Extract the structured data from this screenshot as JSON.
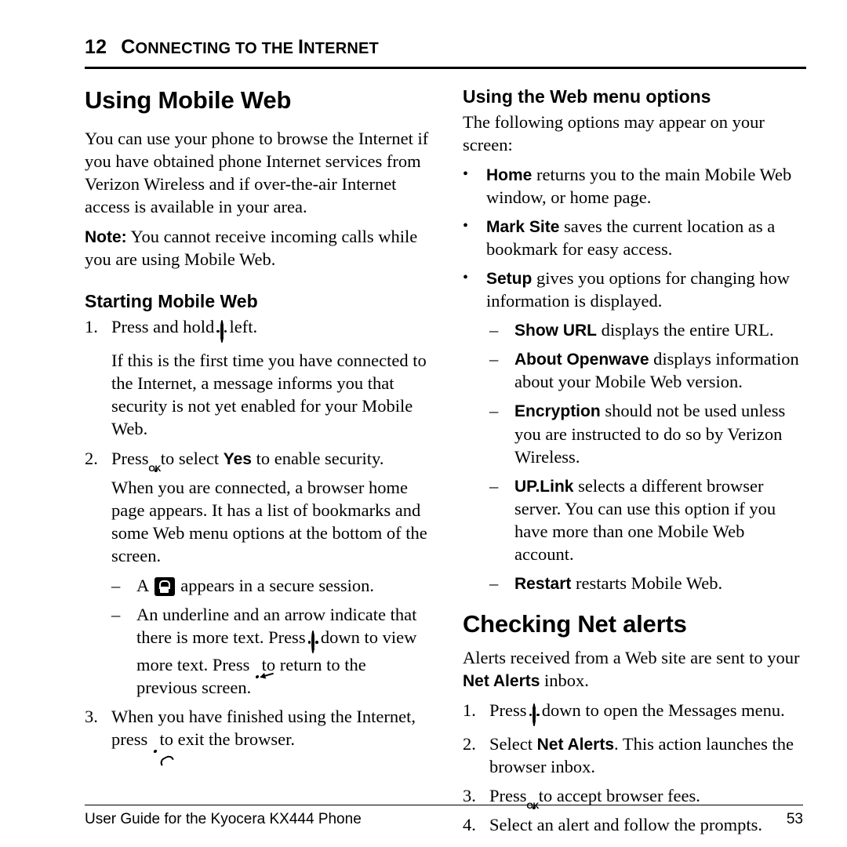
{
  "header": {
    "chapter_number": "12",
    "chapter_title_first": "C",
    "chapter_title_rest": "ONNECTING TO THE ",
    "chapter_title_i": "I",
    "chapter_title_tail": "NTERNET",
    "chapter_title_plain": "12 CONNECTING TO THE INTERNET"
  },
  "left": {
    "title": "Using Mobile Web",
    "intro": "You can use your phone to browse the Internet if you have obtained phone Internet services from Verizon Wireless and if over-the-air Internet access is available in your area.",
    "note_label": "Note:",
    "note_text": " You cannot receive incoming calls while you are using Mobile Web.",
    "starting_title": "Starting Mobile Web",
    "step1_marker": "1.",
    "step1_a": "Press and hold",
    "step1_b": "left.",
    "step1_follow": "If this is the first time you have connected to the Internet, a message informs you that security is not yet enabled for your Mobile Web.",
    "step2_marker": "2.",
    "step2_a": "Press",
    "step2_b": "to select",
    "step2_bold": "Yes",
    "step2_c": "to enable security.",
    "step2_follow": "When you are connected, a browser home page appears. It has a list of bookmarks and some Web menu options at the bottom of the screen.",
    "dash1_marker": "–",
    "dash1_a": "A",
    "dash1_b": "appears in a secure session.",
    "dash2_marker": "–",
    "dash2_a": "An underline and an arrow indicate that there is more text. Press",
    "dash2_b": "down to view more text. Press",
    "dash2_c": "to return to the previous screen.",
    "step3_marker": "3.",
    "step3_a": "When you have finished using the Internet, press",
    "step3_b": "to exit the browser."
  },
  "right": {
    "menu_title": "Using the Web menu options",
    "menu_intro": "The following options may appear on your screen:",
    "bullets": [
      {
        "marker": "•",
        "bold": "Home",
        "text": " returns you to the main Mobile Web window, or home page."
      },
      {
        "marker": "•",
        "bold": "Mark Site",
        "text": " saves the current location as a bookmark for easy access."
      },
      {
        "marker": "•",
        "bold": "Setup",
        "text": " gives you options for changing how information is displayed."
      }
    ],
    "sub_dashes": [
      {
        "marker": "–",
        "bold": "Show URL",
        "text": " displays the entire URL."
      },
      {
        "marker": "–",
        "bold": "About Openwave",
        "text": " displays information about your Mobile Web version."
      },
      {
        "marker": "–",
        "bold": "Encryption",
        "text": " should not be used unless you are instructed to do so by Verizon Wireless."
      },
      {
        "marker": "–",
        "bold": "UP.Link",
        "text": " selects a different browser server. You can use this option if you have more than one Mobile Web account."
      },
      {
        "marker": "–",
        "bold": "Restart",
        "text": " restarts Mobile Web."
      }
    ],
    "alerts_title": "Checking Net alerts",
    "alerts_intro_a": "Alerts received from a Web site are sent to your ",
    "alerts_intro_bold": "Net Alerts",
    "alerts_intro_b": " inbox.",
    "a_step1_marker": "1.",
    "a_step1_a": "Press",
    "a_step1_b": "down to open the Messages menu.",
    "a_step2_marker": "2.",
    "a_step2_a": "Select ",
    "a_step2_bold": "Net Alerts",
    "a_step2_b": ". This action launches the browser inbox.",
    "a_step3_marker": "3.",
    "a_step3_a": "Press",
    "a_step3_b": "to accept browser fees.",
    "a_step4_marker": "4.",
    "a_step4_a": "Select an alert and follow the prompts."
  },
  "footer": {
    "left_text": "User Guide for the Kyocera KX444 Phone",
    "page_number": "53"
  },
  "icons": {
    "nav": "navigation-key-icon",
    "ok": "ok-key-icon",
    "back": "back-key-icon",
    "end": "end-call-key-icon",
    "lock": "lock-icon"
  }
}
